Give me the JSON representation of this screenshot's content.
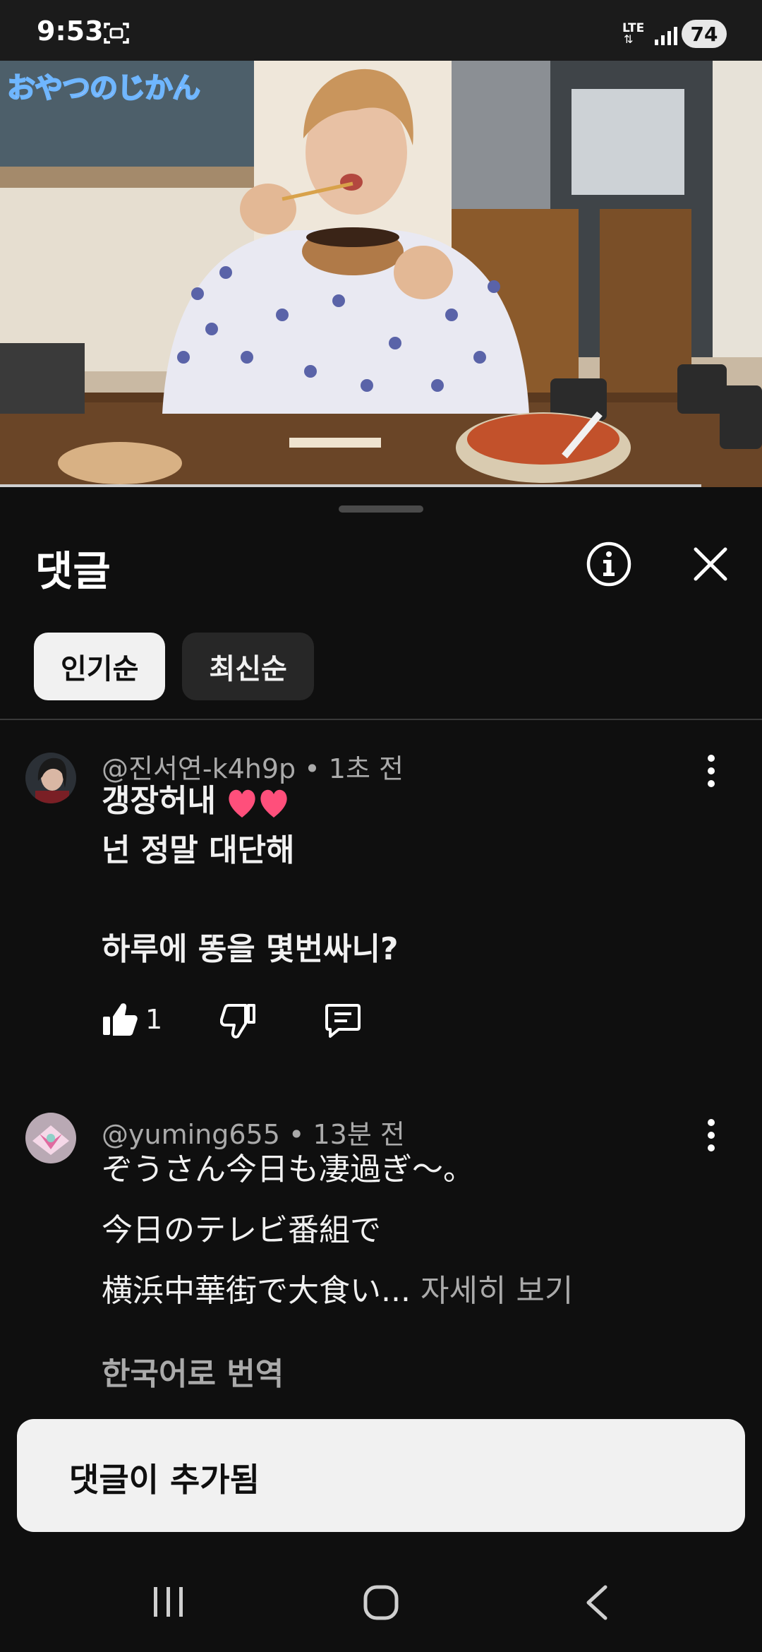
{
  "status_bar": {
    "time": "9:53",
    "network": "LTE",
    "battery": "74"
  },
  "video": {
    "overlay_text": "おやつのじかん",
    "progress": 0.92
  },
  "comments_sheet": {
    "title": "댓글",
    "sort_chips": [
      {
        "label": "인기순",
        "active": true
      },
      {
        "label": "최신순",
        "active": false
      }
    ],
    "comments": [
      {
        "author": "@진서연-k4h9p",
        "time": "1초 전",
        "lines": [
          "갱장허내",
          "넌 정말 대단해",
          "",
          "하루에 똥을 몇번싸니?"
        ],
        "likes": "1"
      },
      {
        "author": "@yuming655",
        "time": "13분 전",
        "lines": [
          "ぞうさん今日も凄過ぎ〜。",
          "今日のテレビ番組で",
          "横浜中華街で大食い..."
        ],
        "read_more": "자세히 보기",
        "translate": "한국어로 번역"
      }
    ]
  },
  "toast": {
    "text": "댓글이 추가됨"
  },
  "icons": {
    "info": "info-icon",
    "close": "close-icon",
    "more": "more-vert-icon",
    "like": "thumb-up-icon",
    "dislike": "thumb-down-icon",
    "reply": "reply-icon"
  },
  "colors": {
    "background": "#0f0f0f",
    "chip_active": "#f1f1f1",
    "chip_inactive": "#272727",
    "secondary_text": "#aaaaaa",
    "heart": "#ff4f7b"
  }
}
